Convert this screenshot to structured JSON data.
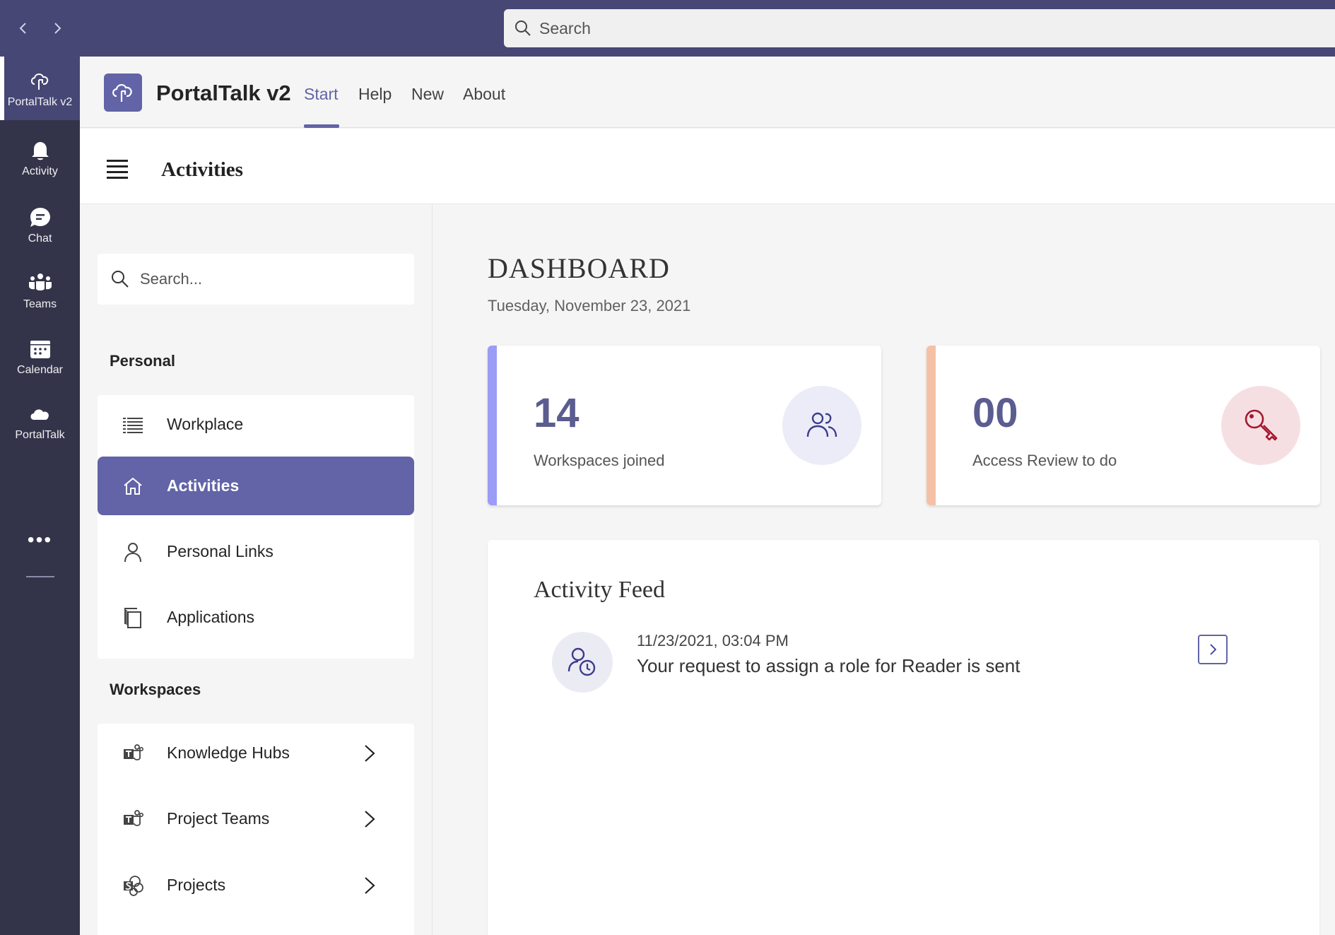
{
  "titlebar": {
    "back_icon": "chevron-left-icon",
    "forward_icon": "chevron-right-icon",
    "search": {
      "placeholder": "Search",
      "icon": "search-icon"
    }
  },
  "rail": {
    "items": [
      {
        "label": "PortalTalk v2",
        "icon": "portaltalk-icon",
        "active": true
      },
      {
        "label": "Activity",
        "icon": "bell-icon"
      },
      {
        "label": "Chat",
        "icon": "chat-icon"
      },
      {
        "label": "Teams",
        "icon": "teams-icon"
      },
      {
        "label": "Calendar",
        "icon": "calendar-icon"
      },
      {
        "label": "PortalTalk",
        "icon": "cloud-icon"
      }
    ],
    "more_label": "•••"
  },
  "app_header": {
    "title": "PortalTalk v2",
    "tabs": [
      {
        "label": "Start",
        "active": true
      },
      {
        "label": "Help"
      },
      {
        "label": "New"
      },
      {
        "label": "About"
      }
    ]
  },
  "page_bar": {
    "title": "Activities"
  },
  "side_panel": {
    "search": {
      "placeholder": "Search..."
    },
    "personal": {
      "label": "Personal",
      "items": [
        {
          "label": "Workplace",
          "icon": "list-icon"
        },
        {
          "label": "Activities",
          "icon": "home-icon",
          "active": true
        },
        {
          "label": "Personal Links",
          "icon": "person-icon"
        },
        {
          "label": "Applications",
          "icon": "copy-icon"
        }
      ]
    },
    "workspaces": {
      "label": "Workspaces",
      "items": [
        {
          "label": "Knowledge Hubs",
          "icon": "teams-app-icon"
        },
        {
          "label": "Project Teams",
          "icon": "teams-app-icon"
        },
        {
          "label": "Projects",
          "icon": "sharepoint-icon"
        }
      ]
    }
  },
  "dashboard": {
    "title": "DASHBOARD",
    "date": "Tuesday, November 23, 2021",
    "cards": [
      {
        "value": "14",
        "label": "Workspaces joined",
        "icon": "people-icon",
        "accent": "#9b9cf5",
        "icon_bg": "#ececf8",
        "icon_color": "#3b3c8c"
      },
      {
        "value": "00",
        "label": "Access Review to do",
        "icon": "key-icon",
        "accent": "#f5c1a6",
        "icon_bg": "#f6dfe2",
        "icon_color": "#a4172e"
      }
    ],
    "activity_feed": {
      "title": "Activity Feed",
      "items": [
        {
          "time": "11/23/2021, 03:04 PM",
          "text": "Your request to assign a role for Reader is sent",
          "icon": "role-request-icon"
        }
      ]
    }
  },
  "colors": {
    "brand": "#6264a7",
    "titlebar": "#464775",
    "rail": "#33344a"
  }
}
